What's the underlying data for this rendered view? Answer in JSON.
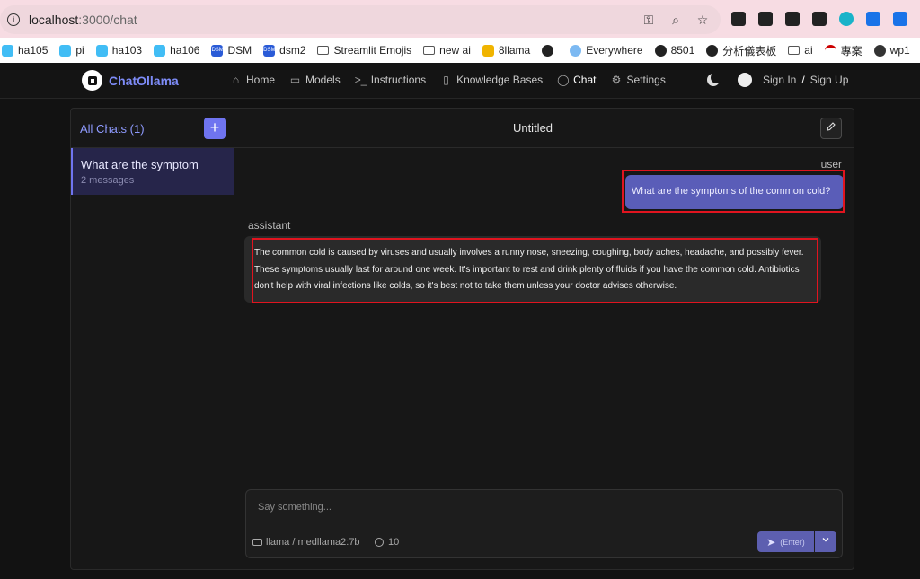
{
  "browser": {
    "url_host": "localhost",
    "url_path": ":3000/chat"
  },
  "bookmarks": [
    {
      "label": "ha105",
      "icon": "home-assistant-icon"
    },
    {
      "label": "pi",
      "icon": "home-assistant-icon"
    },
    {
      "label": "ha103",
      "icon": "home-assistant-icon"
    },
    {
      "label": "ha106",
      "icon": "home-assistant-icon"
    },
    {
      "label": "DSM",
      "icon": "dsm-icon"
    },
    {
      "label": "dsm2",
      "icon": "dsm-icon"
    },
    {
      "label": "Streamlit Emojis",
      "icon": "folder-icon"
    },
    {
      "label": "new ai",
      "icon": "folder-icon"
    },
    {
      "label": "8llama",
      "icon": "store-icon"
    },
    {
      "label": "",
      "icon": "crown-icon"
    },
    {
      "label": "Everywhere",
      "icon": "cloud-icon"
    },
    {
      "label": "8501",
      "icon": "crown-icon"
    },
    {
      "label": "分析儀表板",
      "icon": "crown-icon"
    },
    {
      "label": "ai",
      "icon": "folder-icon"
    },
    {
      "label": "專案",
      "icon": "arc-icon"
    },
    {
      "label": "wp1",
      "icon": "globe-icon"
    }
  ],
  "app": {
    "name": "ChatOllama",
    "nav": [
      {
        "label": "Home",
        "icon": "home-icon"
      },
      {
        "label": "Models",
        "icon": "models-icon"
      },
      {
        "label": "Instructions",
        "icon": "terminal-icon"
      },
      {
        "label": "Knowledge Bases",
        "icon": "book-icon"
      },
      {
        "label": "Chat",
        "icon": "chat-icon",
        "active": true
      },
      {
        "label": "Settings",
        "icon": "gear-icon"
      }
    ],
    "sign_in": "Sign In",
    "separator": "/",
    "sign_up": "Sign Up"
  },
  "sidebar": {
    "title": "All Chats (1)",
    "add_label": "+",
    "chats": [
      {
        "title": "What are the symptom",
        "subtitle": "2 messages"
      }
    ]
  },
  "chat": {
    "title": "Untitled",
    "messages": [
      {
        "role": "user",
        "text": "What are the symptoms of the common cold?"
      },
      {
        "role": "assistant",
        "text": "The common cold is caused by viruses and usually involves a runny nose, sneezing, coughing, body aches, headache, and possibly fever. These symptoms usually last for around one week. It's important to rest and drink plenty of fluids if you have the common cold. Antibiotics don't help with viral infections like colds, so it's best not to take them unless your doctor advises otherwise."
      }
    ]
  },
  "composer": {
    "placeholder": "Say something...",
    "model": "llama / medllama2:7b",
    "history_count": "10",
    "send_label": "(Enter)"
  },
  "colors": {
    "accent": "#6f74f0",
    "highlight": "#e0141f"
  }
}
